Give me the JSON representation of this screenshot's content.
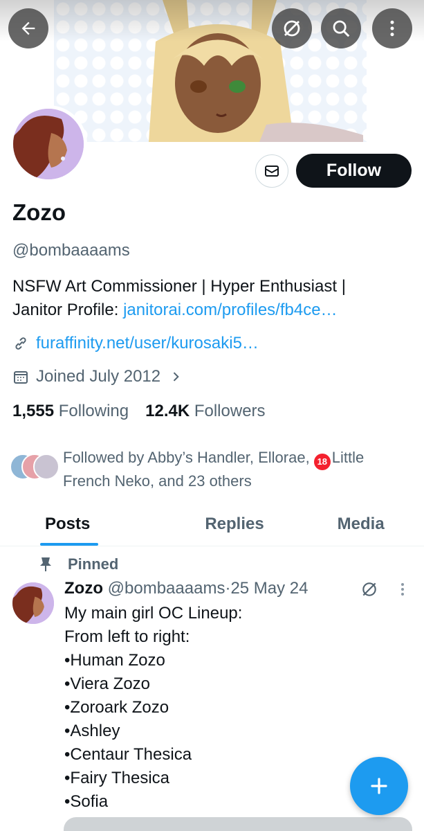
{
  "header": {
    "back_icon": "arrow-left-icon",
    "grok_icon": "slashed-circle-icon",
    "search_icon": "search-icon",
    "more_icon": "more-vertical-icon"
  },
  "profile": {
    "name": "Zozo",
    "handle": "@bombaaaams",
    "follow_label": "Follow",
    "bio_line1": "NSFW Art Commissioner | Hyper Enthusiast |",
    "bio_line2_prefix": "Janitor Profile: ",
    "bio_link": "janitorai.com/profiles/fb4ce…",
    "website": "furaffinity.net/user/kurosaki5…",
    "joined": "Joined July 2012",
    "following_count": "1,555",
    "following_label": "Following",
    "followers_count": "12.4K",
    "followers_label": "Followers",
    "followed_by_prefix": "Followed by Abby’s Handler, Ellorae, ",
    "badge_text": "18",
    "followed_by_line1_end": "Little",
    "followed_by_line2": "French Neko, and 23 others"
  },
  "tabs": [
    {
      "label": "Posts",
      "active": true
    },
    {
      "label": "Replies",
      "active": false
    },
    {
      "label": "Media",
      "active": false
    }
  ],
  "post": {
    "pinned_label": "Pinned",
    "author": "Zozo",
    "handle": "@bombaaaams",
    "separator": "·",
    "date": "25 May 24",
    "lines": [
      "My main girl OC Lineup:",
      "From left to right:",
      "•Human Zozo",
      "•Viera Zozo",
      "•Zoroark Zozo",
      "•Ashley",
      "•Centaur Thesica",
      "•Fairy Thesica",
      "•Sofia"
    ]
  },
  "colors": {
    "accent": "#1d9bf0",
    "text": "#0f1419",
    "secondary": "#536471"
  }
}
